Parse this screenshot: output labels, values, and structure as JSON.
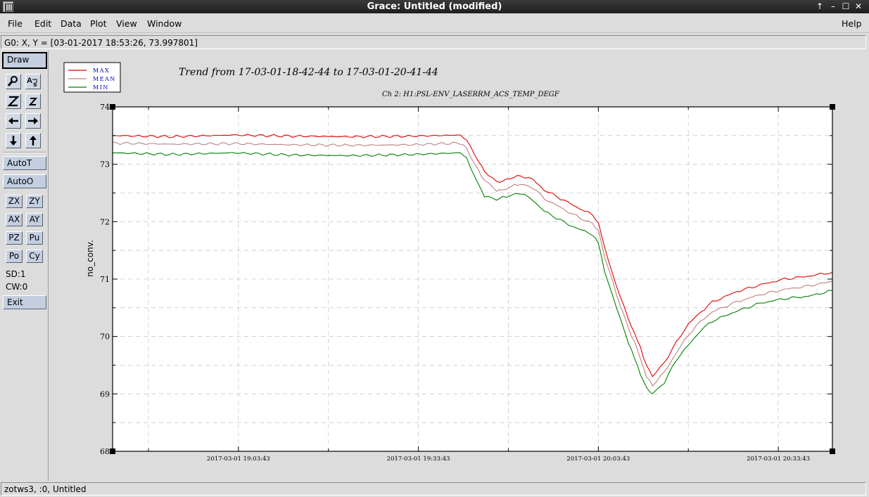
{
  "window": {
    "title": "Grace: Untitled (modified)",
    "buttons": {
      "up": "↑",
      "minimize": "–",
      "maximize": "☐",
      "close": "✕"
    }
  },
  "menu": {
    "file": "File",
    "edit": "Edit",
    "data": "Data",
    "plot": "Plot",
    "view": "View",
    "window": "Window",
    "help": "Help"
  },
  "locator": "G0: X, Y = [03-01-2017 18:53:26, 73.997801]",
  "toolbar": {
    "draw": "Draw",
    "autot": "AutoT",
    "autoo": "AutoO",
    "zx": "ZX",
    "zy": "ZY",
    "ax": "AX",
    "ay": "AY",
    "pz": "PZ",
    "pu": "Pu",
    "po": "Po",
    "cy": "Cy",
    "sd": "SD:1",
    "cw": "CW:0",
    "exit": "Exit",
    "icons": [
      "magnifier-icon",
      "autoscale-text-icon",
      "zoom-in-icon",
      "zoom-out-icon",
      "arrow-left-icon",
      "arrow-right-icon",
      "arrow-down-icon",
      "arrow-up-icon"
    ]
  },
  "status": "zotws3, :0, Untitled",
  "colors": {
    "max": "#e00000",
    "mean": "#c08080",
    "min": "#008000",
    "legend_text": "#0000cc"
  },
  "chart_data": {
    "type": "line",
    "title": "Trend from 17-03-01-18-42-44 to 17-03-01-20-41-44",
    "subtitle": "Ch 2: H1:PSL-ENV_LASERRM_ACS_TEMP_DEGF",
    "xlabel": "",
    "ylabel": "no_conv.",
    "ylim": [
      68,
      74
    ],
    "yticks": [
      "68",
      "69",
      "70",
      "71",
      "72",
      "73",
      "74"
    ],
    "xticks": [
      {
        "t": 20.98,
        "label": "2017-03-01 19:03:43"
      },
      {
        "t": 50.98,
        "label": "2017-03-01 19:33:43"
      },
      {
        "t": 80.98,
        "label": "2017-03-01 20:03:43"
      },
      {
        "t": 110.98,
        "label": "2017-03-01 20:33:43"
      }
    ],
    "xlim": [
      0,
      120
    ],
    "grid": true,
    "legend_position": "top-left",
    "x_minutes_from": "2017-03-01 18:42:44",
    "series": [
      {
        "name": "MAX",
        "x": [
          0,
          10,
          20,
          30,
          40,
          50,
          58,
          59,
          61,
          62,
          64,
          65,
          67,
          68,
          70,
          72,
          76,
          78,
          80,
          81,
          82,
          84,
          86,
          87,
          88,
          89,
          90,
          92,
          94,
          96,
          98,
          100,
          104,
          108,
          112,
          116,
          120
        ],
        "values": [
          73.5,
          73.48,
          73.51,
          73.49,
          73.48,
          73.49,
          73.51,
          73.42,
          73.05,
          72.88,
          72.7,
          72.7,
          72.78,
          72.8,
          72.74,
          72.55,
          72.33,
          72.22,
          72.12,
          71.98,
          71.55,
          70.88,
          70.3,
          70.06,
          69.8,
          69.5,
          69.3,
          69.55,
          69.9,
          70.22,
          70.42,
          70.6,
          70.78,
          70.9,
          71.0,
          71.05,
          71.12
        ]
      },
      {
        "name": "MEAN",
        "x": [
          0,
          10,
          20,
          30,
          40,
          50,
          58,
          59,
          61,
          62,
          64,
          65,
          67,
          68,
          70,
          72,
          76,
          78,
          80,
          81,
          82,
          84,
          86,
          87,
          88,
          89,
          90,
          92,
          94,
          96,
          98,
          100,
          104,
          108,
          112,
          116,
          120
        ],
        "values": [
          73.37,
          73.35,
          73.36,
          73.34,
          73.33,
          73.34,
          73.37,
          73.28,
          72.88,
          72.72,
          72.55,
          72.55,
          72.63,
          72.65,
          72.6,
          72.4,
          72.17,
          72.06,
          71.97,
          71.84,
          71.4,
          70.74,
          70.14,
          69.9,
          69.62,
          69.3,
          69.15,
          69.38,
          69.72,
          70.03,
          70.26,
          70.43,
          70.6,
          70.73,
          70.82,
          70.88,
          70.96
        ]
      },
      {
        "name": "MIN",
        "x": [
          0,
          10,
          20,
          30,
          40,
          50,
          58,
          59,
          61,
          62,
          64,
          65,
          67,
          68,
          70,
          72,
          76,
          78,
          80,
          81,
          82,
          84,
          86,
          87,
          88,
          89,
          90,
          92,
          94,
          96,
          98,
          100,
          104,
          108,
          112,
          116,
          120
        ],
        "values": [
          73.2,
          73.17,
          73.2,
          73.16,
          73.15,
          73.17,
          73.2,
          73.1,
          72.65,
          72.45,
          72.38,
          72.42,
          72.48,
          72.5,
          72.38,
          72.18,
          71.95,
          71.86,
          71.78,
          71.62,
          71.15,
          70.5,
          69.9,
          69.62,
          69.35,
          69.1,
          69.0,
          69.2,
          69.6,
          69.85,
          70.1,
          70.27,
          70.44,
          70.58,
          70.66,
          70.7,
          70.8
        ]
      }
    ]
  }
}
